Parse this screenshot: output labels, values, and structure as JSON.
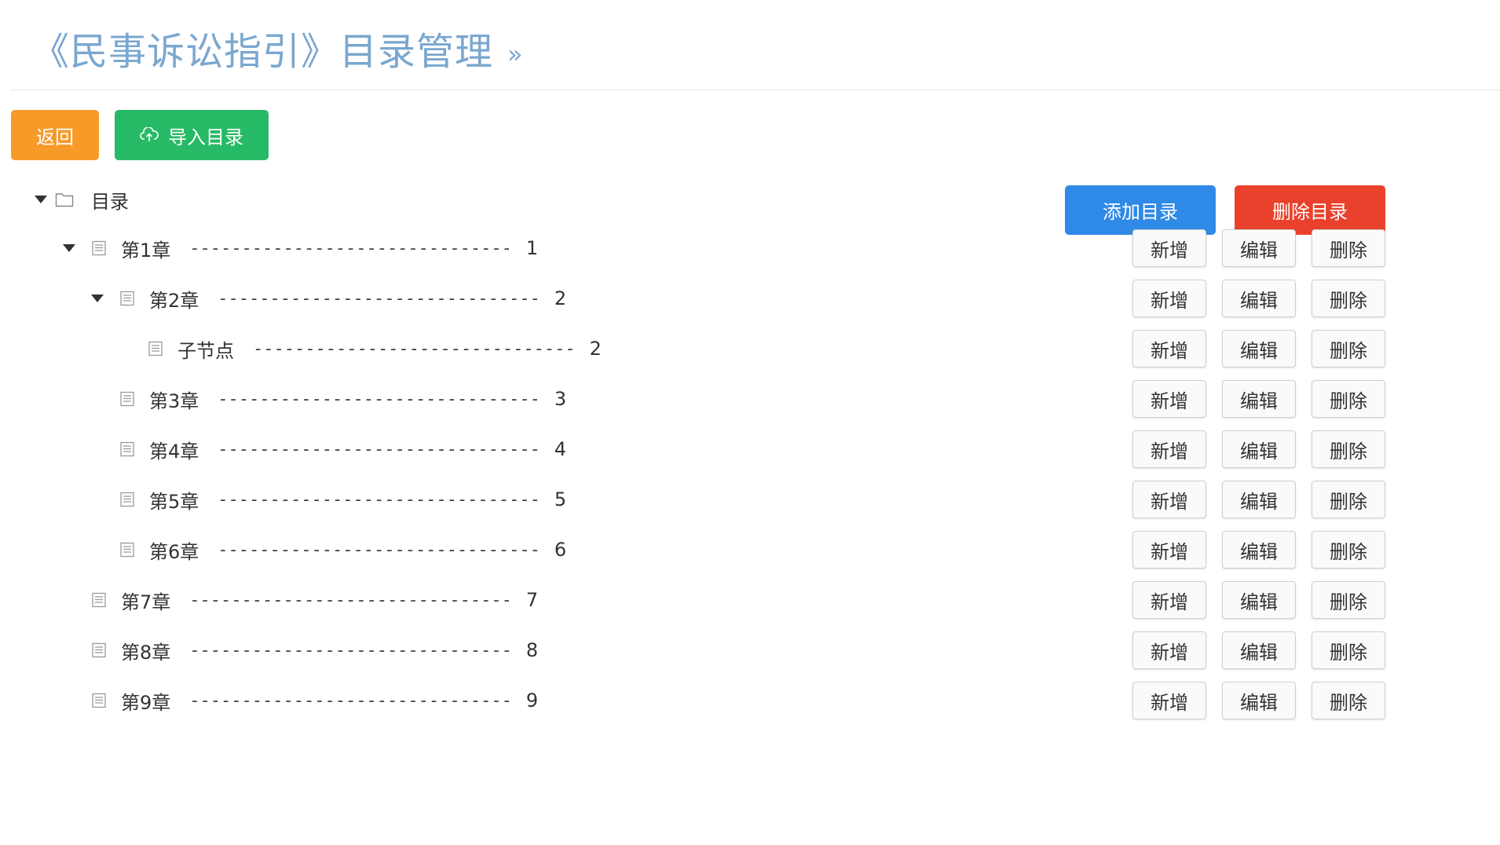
{
  "header": {
    "title": "《民事诉讼指引》目录管理",
    "chevron": "»"
  },
  "toolbar": {
    "back_label": "返回",
    "import_label": "导入目录"
  },
  "tree_actions": {
    "add_label": "添加目录",
    "delete_label": "删除目录"
  },
  "tree": {
    "root_label": "目录",
    "dash_leader": "-------------------------------",
    "row_actions": {
      "add": "新增",
      "edit": "编辑",
      "delete": "删除"
    },
    "nodes": [
      {
        "label": "第1章",
        "page": "1"
      },
      {
        "label": "第2章",
        "page": "2"
      },
      {
        "label": "子节点",
        "page": "2"
      },
      {
        "label": "第3章",
        "page": "3"
      },
      {
        "label": "第4章",
        "page": "4"
      },
      {
        "label": "第5章",
        "page": "5"
      },
      {
        "label": "第6章",
        "page": "6"
      },
      {
        "label": "第7章",
        "page": "7"
      },
      {
        "label": "第8章",
        "page": "8"
      },
      {
        "label": "第9章",
        "page": "9"
      }
    ]
  },
  "colors": {
    "title": "#7aa7cf",
    "back": "#f79a28",
    "import": "#27ba66",
    "add": "#2f89e6",
    "delete": "#e9412b"
  },
  "icons": [
    "chevron-double-right-icon",
    "upload-cloud-icon",
    "caret-down-icon",
    "folder-icon",
    "document-icon"
  ]
}
